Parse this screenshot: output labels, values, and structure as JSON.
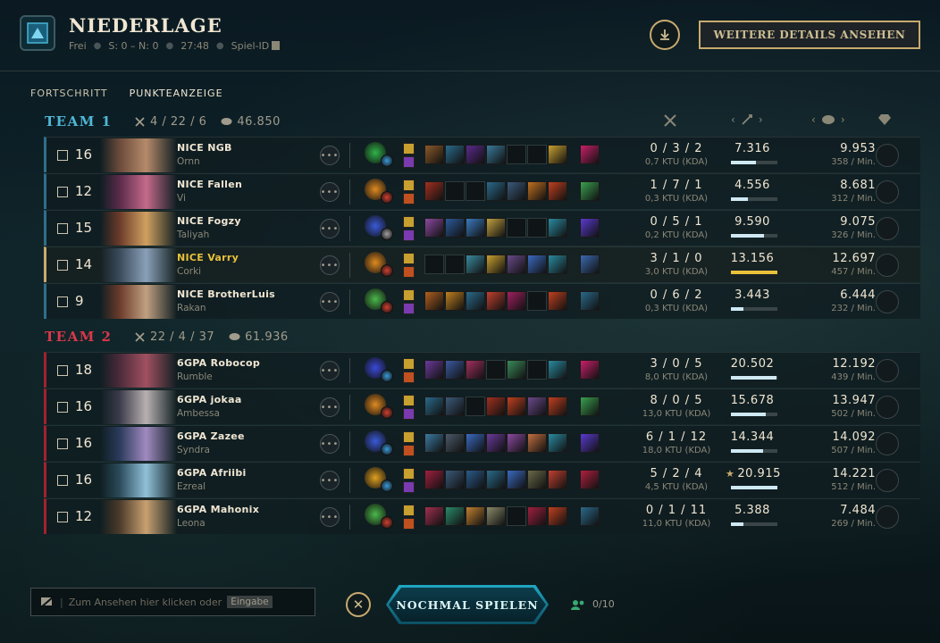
{
  "header": {
    "result": "NIEDERLAGE",
    "mode": "Frei",
    "score": "S: 0 – N: 0",
    "duration": "27:48",
    "game_id_label": "Spiel-ID",
    "details_button": "WEITERE DETAILS ANSEHEN"
  },
  "tabs": [
    "FORTSCHRITT",
    "PUNKTEANZEIGE"
  ],
  "columns": {
    "damage_nav": "‹ ›",
    "gold_nav": "‹ ›"
  },
  "team1": {
    "name": "TEAM 1",
    "kda": "4 / 22 / 6",
    "gold": "46.850",
    "players": [
      {
        "level": "16",
        "name": "NICE NGB",
        "champion": "Ornn",
        "kda": "0 / 3 / 2",
        "kda_sub": "0,7 KTU (KDA)",
        "damage": "7.316",
        "damage_fraction": 0.54,
        "gold": "9.953",
        "gpm": "358 / Min."
      },
      {
        "level": "12",
        "name": "NICE Fallen",
        "champion": "Vi",
        "kda": "1 / 7 / 1",
        "kda_sub": "0,3 KTU (KDA)",
        "damage": "4.556",
        "damage_fraction": 0.36,
        "gold": "8.681",
        "gpm": "312 / Min."
      },
      {
        "level": "15",
        "name": "NICE Fogzy",
        "champion": "Taliyah",
        "kda": "0 / 5 / 1",
        "kda_sub": "0,2 KTU (KDA)",
        "damage": "9.590",
        "damage_fraction": 0.72,
        "gold": "9.075",
        "gpm": "326 / Min."
      },
      {
        "level": "14",
        "name": "NICE Varry",
        "champion": "Corki",
        "kda": "3 / 1 / 0",
        "kda_sub": "3,0 KTU (KDA)",
        "damage": "13.156",
        "damage_fraction": 1.0,
        "gold": "12.697",
        "gpm": "457 / Min."
      },
      {
        "level": "9",
        "name": "NICE BrotherLuis",
        "champion": "Rakan",
        "kda": "0 / 6 / 2",
        "kda_sub": "0,3 KTU (KDA)",
        "damage": "3.443",
        "damage_fraction": 0.26,
        "gold": "6.444",
        "gpm": "232 / Min."
      }
    ]
  },
  "team2": {
    "name": "TEAM 2",
    "kda": "22 / 4 / 37",
    "gold": "61.936",
    "players": [
      {
        "level": "18",
        "name": "6GPA Robocop",
        "champion": "Rumble",
        "kda": "3 / 0 / 5",
        "kda_sub": "8,0 KTU (KDA)",
        "damage": "20.502",
        "damage_fraction": 0.98,
        "gold": "12.192",
        "gpm": "439 / Min."
      },
      {
        "level": "16",
        "name": "6GPA jokaa",
        "champion": "Ambessa",
        "kda": "8 / 0 / 5",
        "kda_sub": "13,0 KTU (KDA)",
        "damage": "15.678",
        "damage_fraction": 0.75,
        "gold": "13.947",
        "gpm": "502 / Min."
      },
      {
        "level": "16",
        "name": "6GPA Zazee",
        "champion": "Syndra",
        "kda": "6 / 1 / 12",
        "kda_sub": "18,0 KTU (KDA)",
        "damage": "14.344",
        "damage_fraction": 0.69,
        "gold": "14.092",
        "gpm": "507 / Min."
      },
      {
        "level": "16",
        "name": "6GPA Afriibi",
        "champion": "Ezreal",
        "kda": "5 / 2 / 4",
        "kda_sub": "4,5 KTU (KDA)",
        "damage": "20.915",
        "damage_fraction": 1.0,
        "gold": "14.221",
        "gpm": "512 / Min.",
        "top_damage": true
      },
      {
        "level": "12",
        "name": "6GPA Mahonix",
        "champion": "Leona",
        "kda": "0 / 1 / 11",
        "kda_sub": "11,0 KTU (KDA)",
        "damage": "5.388",
        "damage_fraction": 0.26,
        "gold": "7.484",
        "gpm": "269 / Min."
      }
    ]
  },
  "footer": {
    "chat_placeholder": "Zum Ansehen hier klicken oder",
    "chat_key": "Eingabe",
    "play_again": "NOCHMAL SPIELEN",
    "party_count": "0/10"
  },
  "colors": {
    "team1": "#4fb7d6",
    "team2": "#d9384b",
    "gold": "#c8aa6e",
    "highlight": "#e8c13a"
  }
}
